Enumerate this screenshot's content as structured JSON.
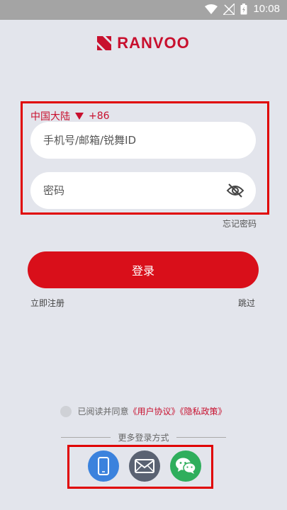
{
  "status_bar": {
    "time": "10:08"
  },
  "brand": {
    "name": "RANVOO",
    "color": "#c8102e"
  },
  "form": {
    "region": "中国大陆",
    "country_code": "+86",
    "account_placeholder": "手机号/邮箱/锐舞ID",
    "password_placeholder": "密码",
    "forgot_label": "忘记密码"
  },
  "actions": {
    "login_label": "登录",
    "register_label": "立即注册",
    "skip_label": "跳过"
  },
  "agreement": {
    "prefix": "已阅读并同意",
    "user_agreement": "《用户协议》",
    "privacy_policy": "《隐私政策》"
  },
  "more_login": {
    "label": "更多登录方式",
    "options": [
      "phone-icon",
      "mail-icon",
      "wechat-icon"
    ]
  },
  "colors": {
    "accent": "#d90f1a",
    "background": "#e3e5ec"
  }
}
